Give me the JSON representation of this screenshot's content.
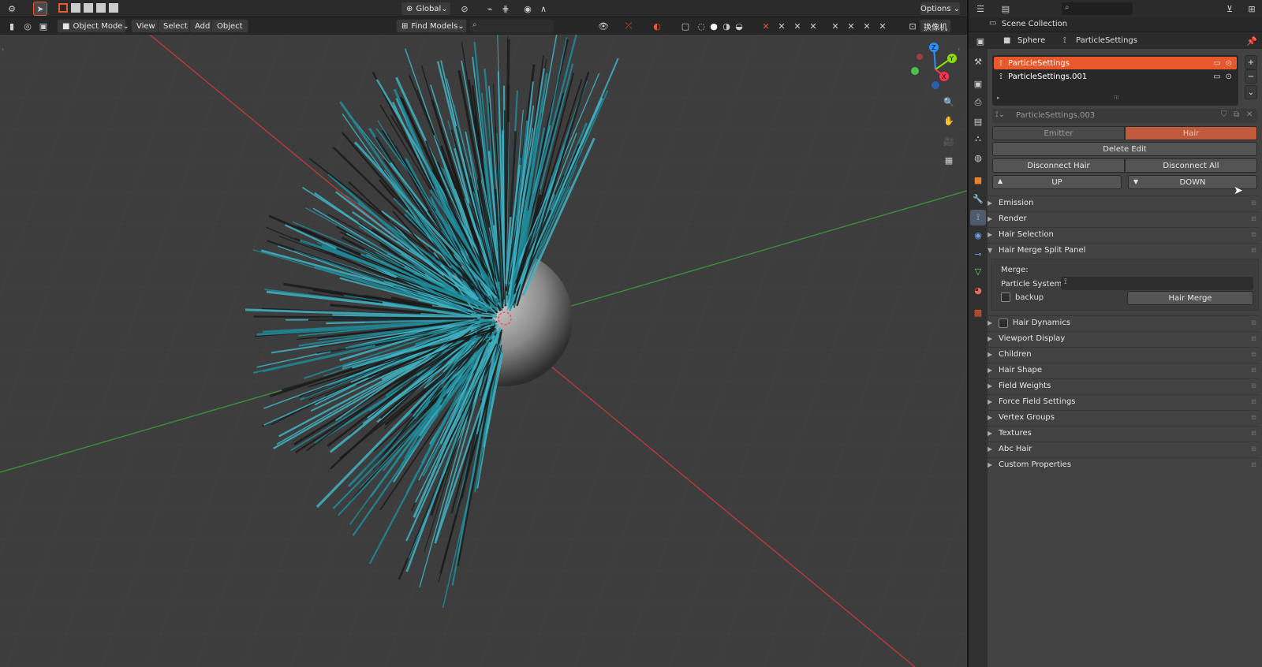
{
  "top_header": {
    "transform_orientation": "Global",
    "options_label": "Options"
  },
  "viewport_header": {
    "mode_label": "Object Mode",
    "menu_view": "View",
    "menu_select": "Select",
    "menu_add": "Add",
    "menu_object": "Object",
    "find_models_label": "Find Models",
    "camera_button_label": "换像机"
  },
  "outliner": {
    "scene_collection_label": "Scene Collection"
  },
  "properties": {
    "breadcrumb_object": "Sphere",
    "breadcrumb_particles": "ParticleSettings",
    "particle_list": [
      {
        "name": "ParticleSettings",
        "selected": true
      },
      {
        "name": "ParticleSettings.001",
        "selected": false
      }
    ],
    "settings_datablock": "ParticleSettings.003",
    "type_emitter": "Emitter",
    "type_hair": "Hair",
    "delete_edit": "Delete Edit",
    "disconnect_hair": "Disconnect Hair",
    "disconnect_all": "Disconnect All",
    "up_label": "UP",
    "down_label": "DOWN",
    "panels_top": [
      "Emission",
      "Render",
      "Hair Selection"
    ],
    "split_panel": {
      "title": "Hair Merge Split Panel",
      "merge_label": "Merge:",
      "particle_system_label": "Particle System:",
      "backup_label": "backup",
      "hair_merge_button": "Hair Merge"
    },
    "hair_dynamics_label": "Hair Dynamics",
    "panels_bottom": [
      "Viewport Display",
      "Children",
      "Hair Shape",
      "Field Weights",
      "Force Field Settings",
      "Vertex Groups",
      "Textures",
      "Abc Hair",
      "Custom Properties"
    ]
  },
  "colors": {
    "accent_orange": "#e8582c",
    "hair_teal": "#1f8a99",
    "axis_x": "#ff3352",
    "axis_y": "#8bdc00",
    "axis_z": "#2890ff"
  },
  "gizmo": {
    "x": "X",
    "y": "Y",
    "z": "Z"
  }
}
